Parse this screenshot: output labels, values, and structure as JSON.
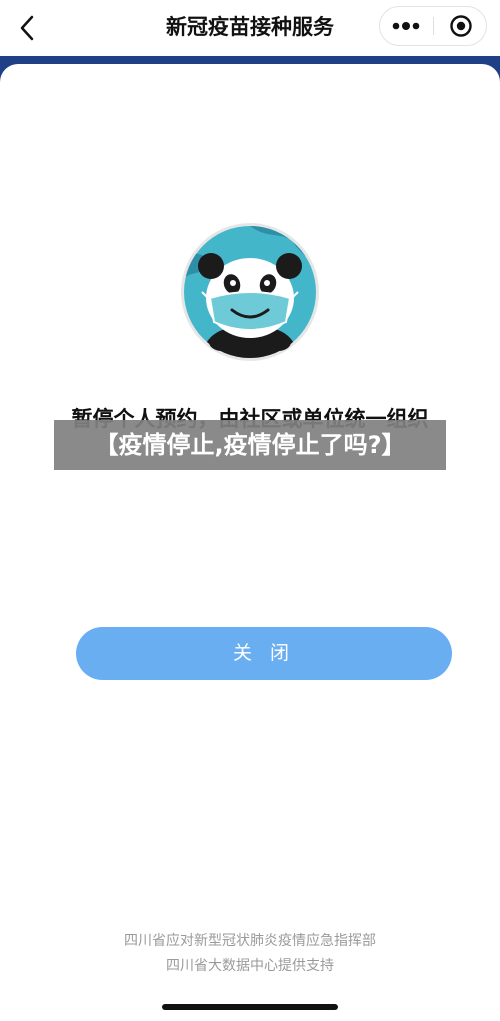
{
  "header": {
    "title": "新冠疫苗接种服务",
    "back_icon": "chevron-left-icon",
    "more_icon": "more-dots-icon",
    "close_icon": "target-close-icon"
  },
  "logo": {
    "icon": "panda-mask-icon",
    "accent": "#44b6c9"
  },
  "dialog": {
    "message": "暂停个人预约，由社区或单位统一组织",
    "close_label": "关 闭"
  },
  "banner": {
    "text": "【疫情停止,疫情停止了吗?】"
  },
  "footer": {
    "line1": "四川省应对新型冠状肺炎疫情应急指挥部",
    "line2": "四川省大数据中心提供支持"
  },
  "colors": {
    "background": "#1f3f86",
    "button": "#6aaef2",
    "banner": "#808080",
    "footer_text": "#9a9a9a"
  }
}
